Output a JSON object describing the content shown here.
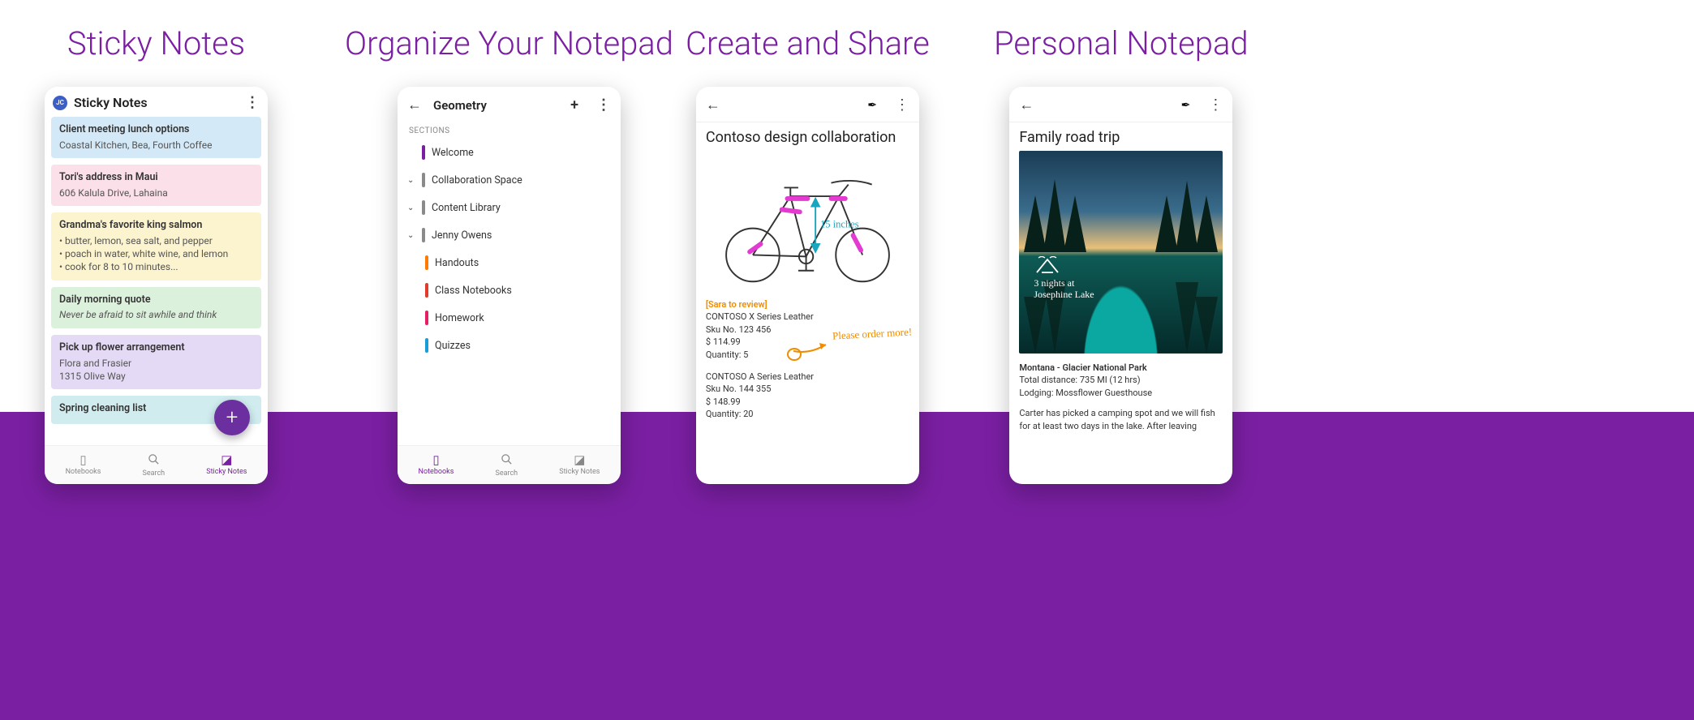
{
  "captions": {
    "c1": "Sticky Notes",
    "c2": "Organize Your Notepad",
    "c3": "Create and Share",
    "c4": "Personal Notepad"
  },
  "screen1": {
    "avatar": "JC",
    "title": "Sticky Notes",
    "notes": [
      {
        "title": "Client meeting lunch options",
        "sub": "Coastal Kitchen, Bea, Fourth Coffee"
      },
      {
        "title": "Tori's address in Maui",
        "sub": "606 Kalula Drive, Lahaina"
      },
      {
        "title": "Grandma's favorite king salmon",
        "l1": "• butter, lemon, sea salt, and pepper",
        "l2": "• poach in water, white wine, and lemon",
        "l3": "• cook for 8 to 10 minutes..."
      },
      {
        "title": "Daily morning quote",
        "sub": "Never be afraid to sit awhile and think"
      },
      {
        "title": "Pick up flower arrangement",
        "l1": "Flora and Frasier",
        "l2": "1315 Olive Way"
      },
      {
        "title": "Spring cleaning list"
      }
    ],
    "nav": {
      "notebooks": "Notebooks",
      "search": "Search",
      "sticky": "Sticky Notes"
    }
  },
  "screen2": {
    "title": "Geometry",
    "sections_label": "SECTIONS",
    "items": {
      "welcome": "Welcome",
      "collab": "Collaboration Space",
      "content": "Content Library",
      "jenny": "Jenny Owens",
      "handouts": "Handouts",
      "class": "Class Notebooks",
      "homework": "Homework",
      "quizzes": "Quizzes"
    },
    "nav": {
      "notebooks": "Notebooks",
      "search": "Search",
      "sticky": "Sticky Notes"
    }
  },
  "screen3": {
    "title": "Contoso design collaboration",
    "measure": "15 inches",
    "review": "[Sara to review]",
    "item1": {
      "name": "CONTOSO X Series Leather",
      "sku": "Sku No. 123 456",
      "price": "$ 114.99",
      "qty": "Quantity: 5"
    },
    "hand": "Please order more!",
    "item2": {
      "name": "CONTOSO A Series Leather",
      "sku": "Sku No. 144 355",
      "price": "$ 148.99",
      "qty": "Quantity: 20"
    }
  },
  "screen4": {
    "title": "Family road trip",
    "overlay1": "3 nights at",
    "overlay2": "Josephine Lake",
    "heading": "Montana - Glacier National Park",
    "dist": "Total distance: 735 MI (12 hrs)",
    "lodging": "Lodging: Mossflower Guesthouse",
    "para": "Carter has picked a camping spot and we will fish for at least two days in the lake. After leaving"
  }
}
